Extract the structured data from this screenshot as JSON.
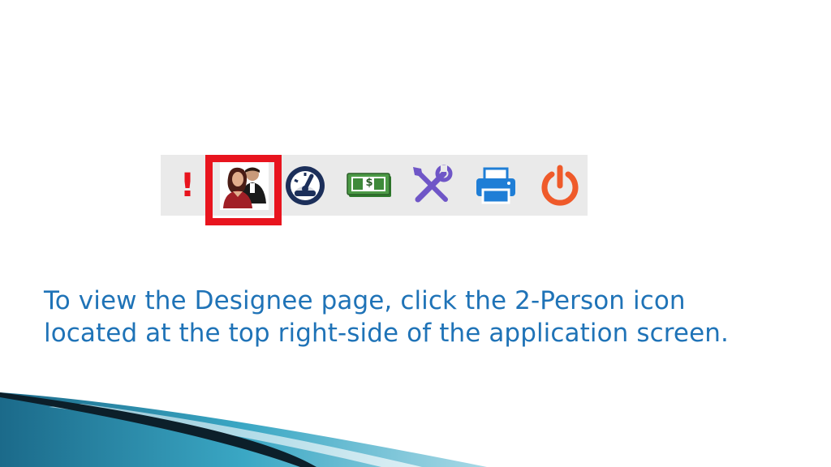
{
  "toolbar": {
    "icons": [
      {
        "name": "alert-icon",
        "highlighted": false
      },
      {
        "name": "two-person-icon",
        "highlighted": true
      },
      {
        "name": "dashboard-gauge-icon",
        "highlighted": false
      },
      {
        "name": "money-icon",
        "highlighted": false
      },
      {
        "name": "tools-icon",
        "highlighted": false
      },
      {
        "name": "printer-icon",
        "highlighted": false
      },
      {
        "name": "power-icon",
        "highlighted": false
      }
    ],
    "alert_glyph": "!",
    "money_glyph": "$"
  },
  "caption": {
    "line1": "To view the Designee page, click the 2-Person icon",
    "line2": "located at the top right-side of the application screen."
  },
  "colors": {
    "caption_text": "#1f73b7",
    "highlight_border": "#e8141e",
    "toolbar_background": "#eaeaea",
    "alert": "#e8141e",
    "gauge": "#1c2f5a",
    "money": "#3e8a3a",
    "tools": "#6f56c7",
    "printer": "#1f7ed6",
    "power": "#ef5a2a"
  }
}
